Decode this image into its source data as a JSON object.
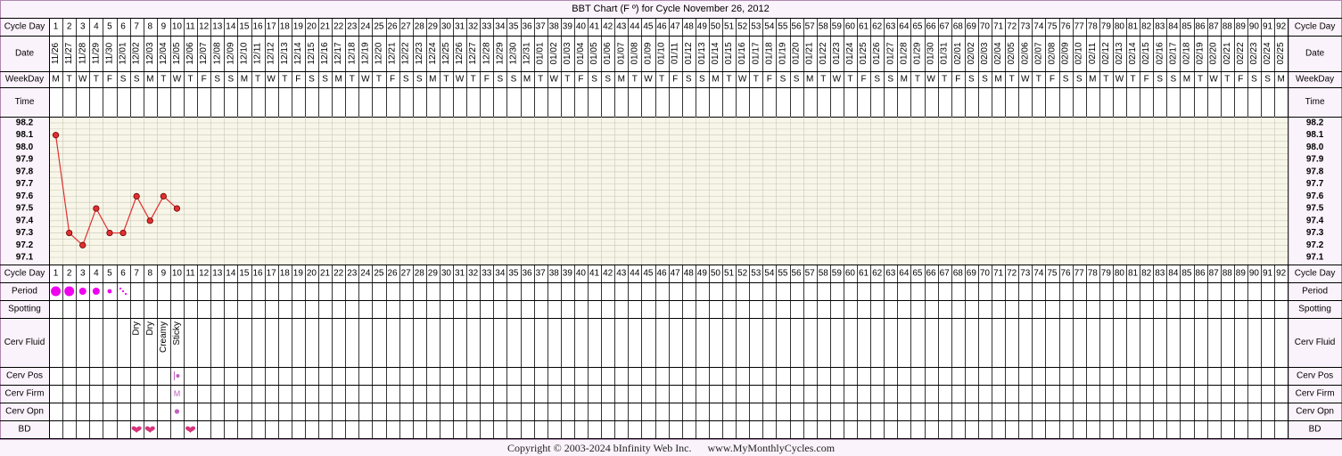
{
  "chart_data": {
    "type": "line",
    "title": "BBT Chart (F º) for Cycle November 26, 2012",
    "row_labels": {
      "cycle_day": "Cycle Day",
      "date": "Date",
      "weekday": "WeekDay",
      "time": "Time",
      "period": "Period",
      "spotting": "Spotting",
      "cerv_fluid": "Cerv Fluid",
      "cerv_pos": "Cerv Pos",
      "cerv_firm": "Cerv Firm",
      "cerv_opn": "Cerv Opn",
      "bd": "BD"
    },
    "cycle_days": [
      1,
      2,
      3,
      4,
      5,
      6,
      7,
      8,
      9,
      10,
      11,
      12,
      13,
      14,
      15,
      16,
      17,
      18,
      19,
      20,
      21,
      22,
      23,
      24,
      25,
      26,
      27,
      28,
      29,
      30,
      31,
      32,
      33,
      34,
      35,
      36,
      37,
      38,
      39,
      40,
      41,
      42,
      43,
      44,
      45,
      46,
      47,
      48,
      49,
      50,
      51,
      52,
      53,
      54,
      55,
      56,
      57,
      58,
      59,
      60,
      61,
      62,
      63,
      64,
      65,
      66,
      67,
      68,
      69,
      70,
      71,
      72,
      73,
      74,
      75,
      76,
      77,
      78,
      79,
      80,
      81,
      82,
      83,
      84,
      85,
      86,
      87,
      88,
      89,
      90,
      91,
      92
    ],
    "dates": [
      "11/26",
      "11/27",
      "11/28",
      "11/29",
      "11/30",
      "12/01",
      "12/02",
      "12/03",
      "12/04",
      "12/05",
      "12/06",
      "12/07",
      "12/08",
      "12/09",
      "12/10",
      "12/11",
      "12/12",
      "12/13",
      "12/14",
      "12/15",
      "12/16",
      "12/17",
      "12/18",
      "12/19",
      "12/20",
      "12/21",
      "12/22",
      "12/23",
      "12/24",
      "12/25",
      "12/26",
      "12/27",
      "12/28",
      "12/29",
      "12/30",
      "12/31",
      "01/01",
      "01/02",
      "01/03",
      "01/04",
      "01/05",
      "01/06",
      "01/07",
      "01/08",
      "01/09",
      "01/10",
      "01/11",
      "01/12",
      "01/13",
      "01/14",
      "01/15",
      "01/16",
      "01/17",
      "01/18",
      "01/19",
      "01/20",
      "01/21",
      "01/22",
      "01/23",
      "01/24",
      "01/25",
      "01/26",
      "01/27",
      "01/28",
      "01/29",
      "01/30",
      "01/31",
      "02/01",
      "02/02",
      "02/03",
      "02/04",
      "02/05",
      "02/06",
      "02/07",
      "02/08",
      "02/09",
      "02/10",
      "02/11",
      "02/12",
      "02/13",
      "02/14",
      "02/15",
      "02/16",
      "02/17",
      "02/18",
      "02/19",
      "02/20",
      "02/21",
      "02/22",
      "02/23",
      "02/24",
      "02/25"
    ],
    "weekdays": [
      "M",
      "T",
      "W",
      "T",
      "F",
      "S",
      "S",
      "M",
      "T",
      "W",
      "T",
      "F",
      "S",
      "S",
      "M",
      "T",
      "W",
      "T",
      "F",
      "S",
      "S",
      "M",
      "T",
      "W",
      "T",
      "F",
      "S",
      "S",
      "M",
      "T",
      "W",
      "T",
      "F",
      "S",
      "S",
      "M",
      "T",
      "W",
      "T",
      "F",
      "S",
      "S",
      "M",
      "T",
      "W",
      "T",
      "F",
      "S",
      "S",
      "M",
      "T",
      "W",
      "T",
      "F",
      "S",
      "S",
      "M",
      "T",
      "W",
      "T",
      "F",
      "S",
      "S",
      "M",
      "T",
      "W",
      "T",
      "F",
      "S",
      "S",
      "M",
      "T",
      "W",
      "T",
      "F",
      "S",
      "S",
      "M",
      "T",
      "W",
      "T",
      "F",
      "S",
      "S",
      "M",
      "T",
      "W",
      "T",
      "F",
      "S",
      "S",
      "M"
    ],
    "temp_axis": {
      "min": 97.1,
      "max": 98.2,
      "ticks": [
        "98.2",
        "98.1",
        "98.0",
        "97.9",
        "97.8",
        "97.7",
        "97.6",
        "97.5",
        "97.4",
        "97.3",
        "97.2",
        "97.1"
      ]
    },
    "temperatures": [
      {
        "day": 1,
        "temp": 98.1
      },
      {
        "day": 2,
        "temp": 97.3
      },
      {
        "day": 3,
        "temp": 97.2
      },
      {
        "day": 4,
        "temp": 97.5
      },
      {
        "day": 5,
        "temp": 97.3
      },
      {
        "day": 6,
        "temp": 97.3
      },
      {
        "day": 7,
        "temp": 97.6
      },
      {
        "day": 8,
        "temp": 97.4
      },
      {
        "day": 9,
        "temp": 97.6
      },
      {
        "day": 10,
        "temp": 97.5
      }
    ],
    "period": [
      {
        "day": 1,
        "flow": "heavy"
      },
      {
        "day": 2,
        "flow": "heavy"
      },
      {
        "day": 3,
        "flow": "medium"
      },
      {
        "day": 4,
        "flow": "medium"
      },
      {
        "day": 5,
        "flow": "light"
      },
      {
        "day": 6,
        "flow": "spotting"
      }
    ],
    "cerv_fluid": [
      {
        "day": 7,
        "label": "Dry"
      },
      {
        "day": 8,
        "label": "Dry"
      },
      {
        "day": 9,
        "label": "Creamy"
      },
      {
        "day": 10,
        "label": "Sticky"
      }
    ],
    "cerv_pos": [
      {
        "day": 10,
        "value": "low"
      }
    ],
    "cerv_firm": [
      {
        "day": 10,
        "label": "M"
      }
    ],
    "cerv_opn": [
      {
        "day": 10,
        "value": "closed"
      }
    ],
    "bd_days": [
      7,
      8,
      11
    ],
    "colors": {
      "temp_line": "#e03030",
      "temp_point": "#e03030",
      "grid_bg": "#f7f6e8",
      "grid_minor": "#c8c8b8",
      "period": "#ee00ee",
      "bd_heart": "#d6337a",
      "cerv_mark": "#c060c0",
      "page_bg": "#fbf3fb"
    }
  },
  "footer": {
    "copyright": "Copyright © 2003-2024 bInfinity Web Inc.",
    "site": "www.MyMonthlyCycles.com"
  }
}
